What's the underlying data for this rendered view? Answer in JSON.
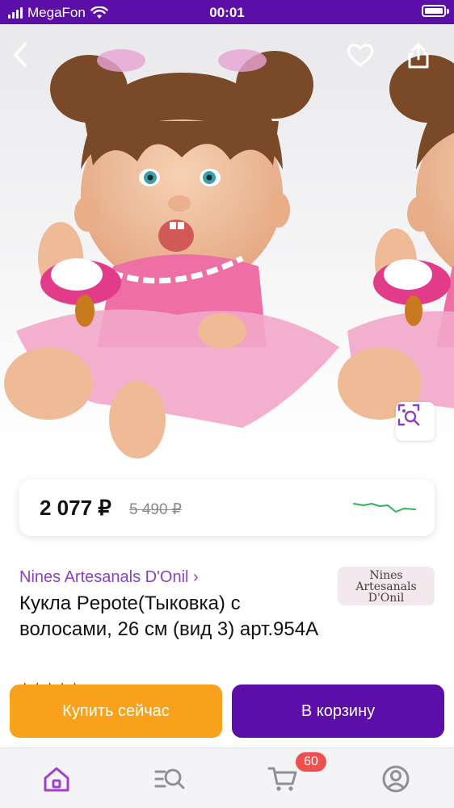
{
  "status_bar": {
    "carrier": "MegaFon",
    "time": "00:01"
  },
  "gallery": {
    "back_icon": "chevron-left-icon",
    "favorite_icon": "heart-icon",
    "share_icon": "share-icon",
    "visual_search_icon": "image-search-icon"
  },
  "price": {
    "current": "2 077 ₽",
    "old": "5 490 ₽",
    "trend_color": "#2fb35a"
  },
  "product": {
    "brand": "Nines Artesanals D'Onil ›",
    "brand_logo_line1": "Nines",
    "brand_logo_line2": "Artesanals",
    "brand_logo_line3": "D'Onil",
    "title": "Кукла Pepote(Тыковка) с волосами, 26 см (вид 3) арт.954А"
  },
  "actions": {
    "buy_now": "Купить сейчас",
    "add_to_cart": "В корзину"
  },
  "tabbar": {
    "items": [
      {
        "icon": "home-icon",
        "active": true
      },
      {
        "icon": "catalog-search-icon",
        "active": false
      },
      {
        "icon": "cart-icon",
        "active": false
      },
      {
        "icon": "profile-icon",
        "active": false
      }
    ],
    "cart_count": "60"
  },
  "colors": {
    "brand": "#5b0fa8",
    "accent_orange": "#f9a11b",
    "link_purple": "#8a3fc4",
    "badge_red": "#ef4f4f"
  }
}
